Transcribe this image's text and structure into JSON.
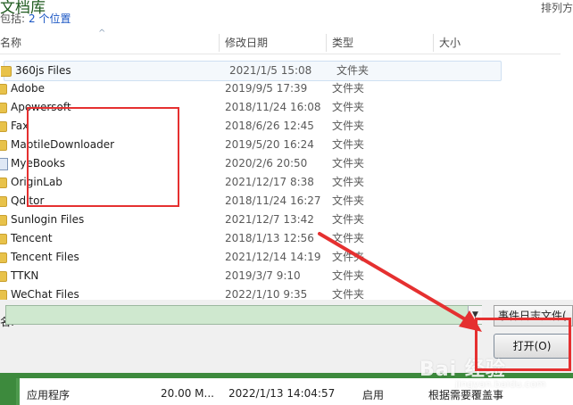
{
  "library": {
    "title": "文档库",
    "includes_label": "包括:",
    "locations_link": "2 个位置",
    "arrange_label": "排列方"
  },
  "columns": {
    "name": "名称",
    "date": "修改日期",
    "type": "类型",
    "size": "大小"
  },
  "files": [
    {
      "name": "360js Files",
      "date": "2021/1/5 15:08",
      "type": "文件夹",
      "icon": "folder-icon"
    },
    {
      "name": "Adobe",
      "date": "2019/9/5 17:39",
      "type": "文件夹",
      "icon": "folder-icon"
    },
    {
      "name": "Apowersoft",
      "date": "2018/11/24 16:08",
      "type": "文件夹",
      "icon": "folder-icon"
    },
    {
      "name": "Fax",
      "date": "2018/6/26 12:45",
      "type": "文件夹",
      "icon": "folder-icon"
    },
    {
      "name": "MaptileDownloader",
      "date": "2019/5/20 16:24",
      "type": "文件夹",
      "icon": "folder-icon"
    },
    {
      "name": "MyeBooks",
      "date": "2020/2/6 20:50",
      "type": "文件夹",
      "icon": "ebook-icon"
    },
    {
      "name": "OriginLab",
      "date": "2021/12/17 8:38",
      "type": "文件夹",
      "icon": "folder-icon"
    },
    {
      "name": "Qditor",
      "date": "2018/11/24 16:27",
      "type": "文件夹",
      "icon": "folder-icon"
    },
    {
      "name": "Sunlogin Files",
      "date": "2021/12/7 13:42",
      "type": "文件夹",
      "icon": "folder-icon"
    },
    {
      "name": "Tencent",
      "date": "2018/1/13 12:56",
      "type": "文件夹",
      "icon": "folder-icon"
    },
    {
      "name": "Tencent Files",
      "date": "2021/12/14 14:19",
      "type": "文件夹",
      "icon": "folder-icon"
    },
    {
      "name": "TTKN",
      "date": "2019/3/7 9:10",
      "type": "文件夹",
      "icon": "folder-icon"
    },
    {
      "name": "WeChat Files",
      "date": "2022/1/10 9:35",
      "type": "文件夹",
      "icon": "folder-icon"
    }
  ],
  "filename": {
    "label": "名:",
    "value": ""
  },
  "filter": {
    "selected": "事件日志文件("
  },
  "open_button": {
    "label": "打开(O)"
  },
  "background_row": {
    "cells": [
      "应用程序",
      "20.00 M...",
      "2022/1/13 14:04:57",
      "启用",
      "根据需要覆盖事"
    ]
  },
  "watermark": {
    "text": "Bai 经验",
    "sub": "jingyan.baidu.com"
  },
  "colors": {
    "annotation_red": "#e53030",
    "input_green": "#cfe8cf",
    "selection_blue": "#cfe0f2"
  }
}
